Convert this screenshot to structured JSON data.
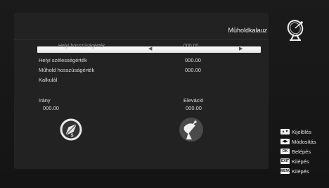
{
  "header": {
    "title": "Müholdkalauz",
    "logo_icon": "satellite-dish-icon"
  },
  "menu": {
    "selected": {
      "label": "Helyi hosszúságérték",
      "value": "000.00"
    },
    "rows": [
      {
        "label": "Helyi szélességérték",
        "value": "000.00"
      },
      {
        "label": "Műhold hosszúságérték",
        "value": "000.00"
      },
      {
        "label": "Kalkulál",
        "value": ""
      }
    ]
  },
  "results": {
    "direction": {
      "label": "Irány",
      "value": "000.00",
      "icon": "compass-icon"
    },
    "elevation": {
      "label": "Eleváció",
      "value": "000.00",
      "icon": "satellite-dish-icon"
    }
  },
  "legend": [
    {
      "key": "updown-key-icon",
      "label": "Kijelölés"
    },
    {
      "key": "leftright-key-icon",
      "label": "Módosítás"
    },
    {
      "key": "ok-key-icon",
      "key_text": "OK",
      "label": "Belépés"
    },
    {
      "key": "exit-key-icon",
      "key_text": "EXIT",
      "label": "Kilépés"
    },
    {
      "key": "menu-key-icon",
      "key_text": "MENU",
      "label": "Kilépés"
    }
  ]
}
